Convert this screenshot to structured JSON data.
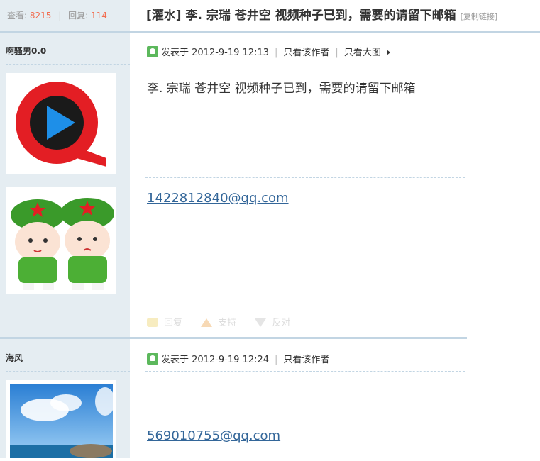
{
  "header": {
    "views_label": "查看:",
    "views_count": "8215",
    "replies_label": "回复:",
    "replies_count": "114",
    "thread_title": "[灌水] 李. 宗瑞 苍井空 视频种子已到，需要的请留下邮箱",
    "copy_link": "[复制链接]"
  },
  "posts": [
    {
      "author": "啊骚男0.0",
      "posted_label": "发表于 2012-9-19 12:13",
      "only_author": "只看该作者",
      "only_big_image": "只看大图",
      "body": "李. 宗瑞 苍井空 视频种子已到，需要的请留下邮箱",
      "signature": "1422812840@qq.com",
      "actions": {
        "reply": "回复",
        "support": "支持",
        "oppose": "反对"
      }
    },
    {
      "author": "海风",
      "posted_label": "发表于 2012-9-19 12:24",
      "only_author": "只看该作者",
      "signature": "569010755@qq.com"
    }
  ],
  "icons": [
    "qq-player-logo",
    "soldier-cartoon-avatar",
    "beach-sky-avatar",
    "post-icon",
    "arrow-right-icon",
    "reply-icon",
    "support-icon",
    "oppose-icon"
  ],
  "colors": {
    "sidebar": "#e5edf2",
    "separator": "#c2d5e3",
    "count": "#f26c4f",
    "link": "#336699"
  }
}
